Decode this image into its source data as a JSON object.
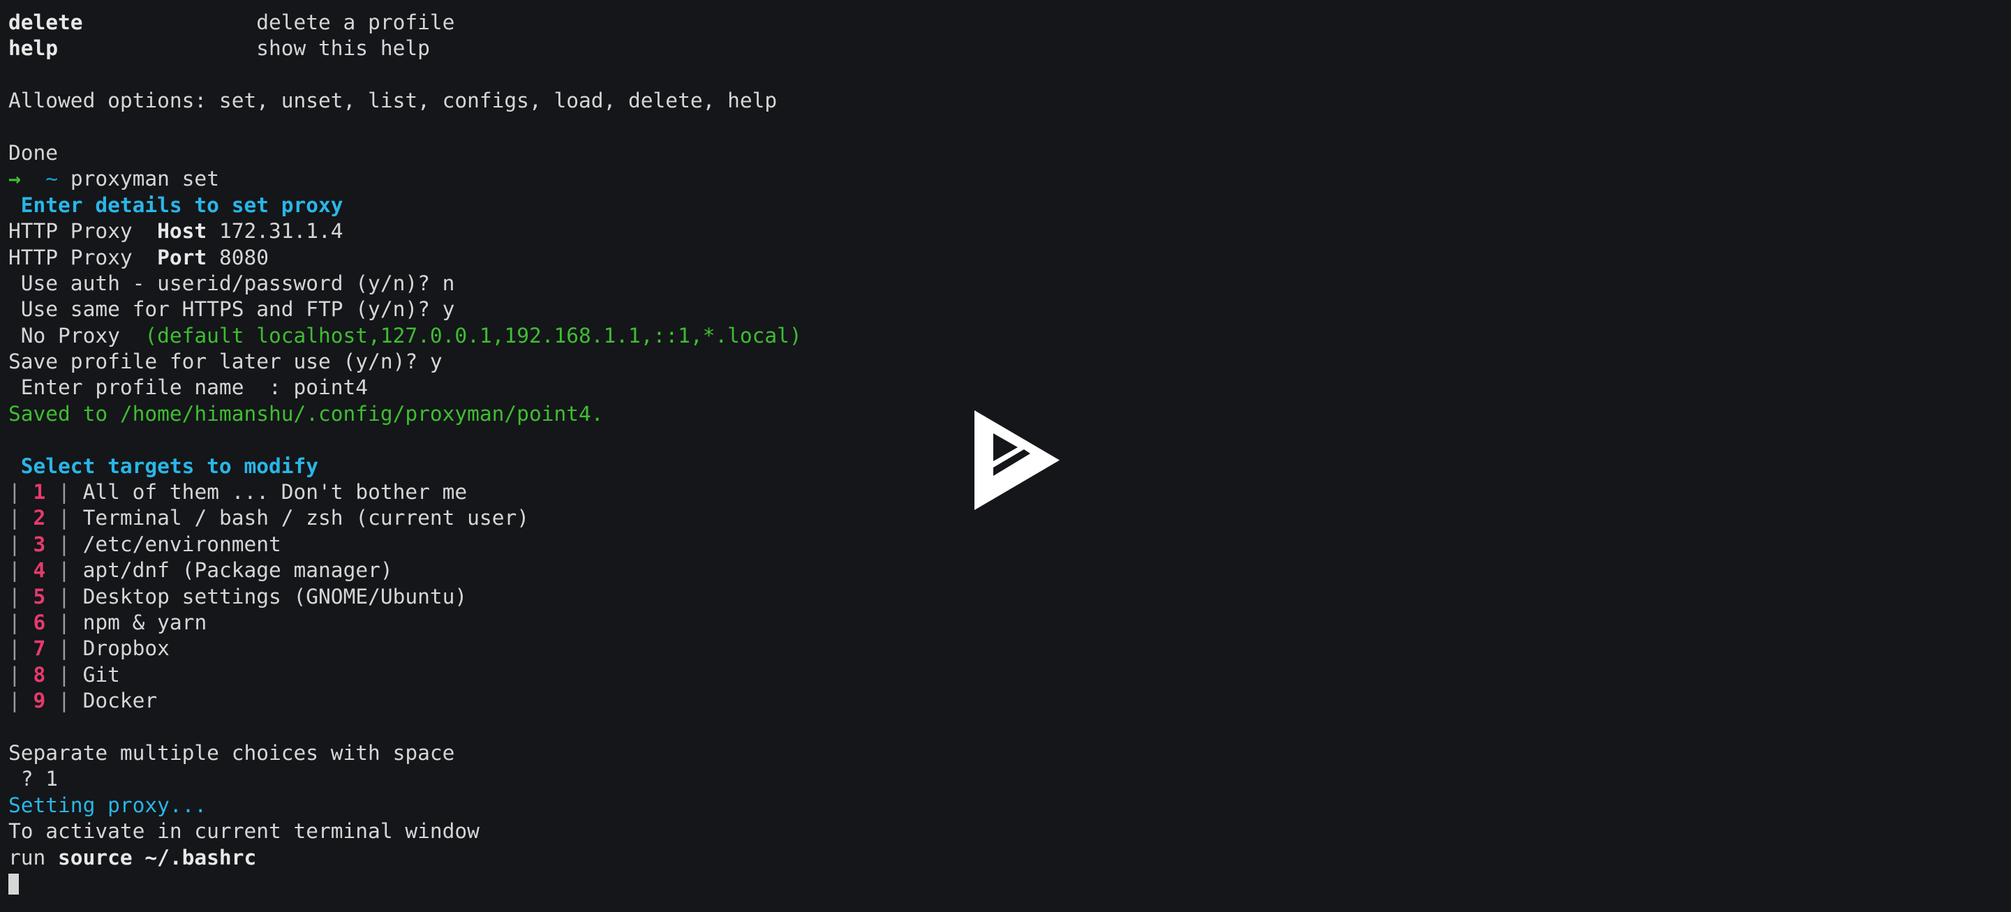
{
  "terminal": {
    "background_color": "#141619",
    "foreground_color": "#d6d6d6",
    "accent_colors": {
      "cyan": "#29b6e8",
      "green": "#3fbd31",
      "pink": "#e63a6e",
      "prompt_tilde": "#1f9ede"
    },
    "help_table": {
      "rows": [
        {
          "command": "delete",
          "description": "delete a profile"
        },
        {
          "command": "help",
          "description": "show this help"
        }
      ]
    },
    "allowed_options_line": "Allowed options: set, unset, list, configs, load, delete, help",
    "done_line": "Done",
    "prompt": {
      "arrow": "→",
      "cwd": "~",
      "command": "proxyman set"
    },
    "set_proxy_heading": "Enter details to set proxy",
    "fields": {
      "http_host_label_prefix": "HTTP Proxy  ",
      "http_host_label": "Host",
      "http_host_value": " 172.31.1.4",
      "http_port_label_prefix": "HTTP Proxy  ",
      "http_port_label": "Port",
      "http_port_value": " 8080",
      "use_auth_line": " Use auth - userid/password (y/n)? n",
      "use_same_line": " Use same for HTTPS and FTP (y/n)? y",
      "no_proxy_label": " No Proxy  ",
      "no_proxy_default": "(default localhost,127.0.0.1,192.168.1.1,::1,*.local)",
      "save_profile_line": "Save profile for later use (y/n)? y",
      "profile_name_line": " Enter profile name  : point4"
    },
    "saved_to_line": "Saved to /home/himanshu/.config/proxyman/point4.",
    "select_targets_heading": "Select targets to modify",
    "targets": [
      {
        "num": "1",
        "label": "All of them ... Don't bother me"
      },
      {
        "num": "2",
        "label": "Terminal / bash / zsh (current user)"
      },
      {
        "num": "3",
        "label": "/etc/environment"
      },
      {
        "num": "4",
        "label": "apt/dnf (Package manager)"
      },
      {
        "num": "5",
        "label": "Desktop settings (GNOME/Ubuntu)"
      },
      {
        "num": "6",
        "label": "npm & yarn"
      },
      {
        "num": "7",
        "label": "Dropbox"
      },
      {
        "num": "8",
        "label": "Git"
      },
      {
        "num": "9",
        "label": "Docker"
      }
    ],
    "separate_choices_line": "Separate multiple choices with space",
    "answer_line": " ? 1",
    "setting_proxy_line": "Setting proxy...",
    "activate_line": "To activate in current terminal window",
    "run_prefix": "run ",
    "run_command": "source ~/.bashrc"
  },
  "overlay": {
    "play_mark_name": "play-button-watermark"
  }
}
